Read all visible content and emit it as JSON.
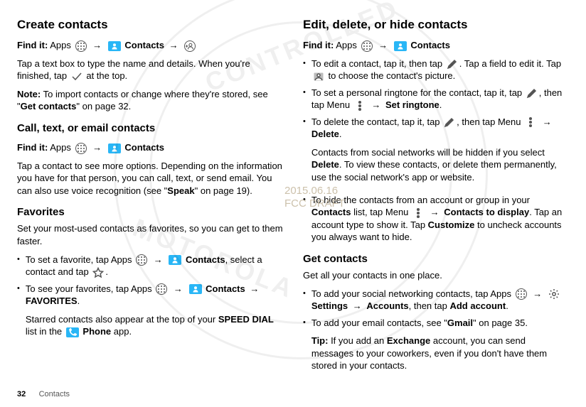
{
  "page": {
    "number": "32",
    "section": "Contacts",
    "arrow": "→"
  },
  "left": {
    "h1": "Create contacts",
    "find1_label": "Find it:",
    "find1_a": "Apps",
    "find1_b": "Contacts",
    "p1a": "Tap a text box to type the name and details. When you're finished, tap ",
    "p1b": " at the top.",
    "note_label": "Note:",
    "note_a": " To import contacts or change where they're stored, see \"",
    "note_b": "Get contacts",
    "note_c": "\" on page 32.",
    "h2": "Call, text, or email contacts",
    "find2_label": "Find it:",
    "find2_a": "Apps",
    "find2_b": "Contacts",
    "p2a": "Tap a contact to see more options. Depending on the information you have for that person, you can call, text, or send email. You can also use voice recognition (see \"",
    "p2b": "Speak",
    "p2c": "\" on page 19).",
    "h3": "Favorites",
    "p3": "Set your most-used contacts as favorites, so you can get to them faster.",
    "b1a": "To set a favorite, tap Apps ",
    "b1b": "Contacts",
    "b1c": ", select a contact and tap ",
    "b1d": ".",
    "b2a": "To see your favorites, tap Apps ",
    "b2b": "Contacts",
    "b2c": "FAVORITES",
    "b2d": ".",
    "b2e": "Starred contacts also appear at the top of your ",
    "b2f": "SPEED DIAL",
    "b2g": " list in the ",
    "b2h": "Phone",
    "b2i": " app."
  },
  "right": {
    "h1": "Edit, delete, or hide contacts",
    "find1_label": "Find it:",
    "find1_a": "Apps",
    "find1_b": "Contacts",
    "e1a": "To edit a contact, tap it, then tap ",
    "e1b": ". Tap a field to edit it. Tap ",
    "e1c": " to choose the contact's picture.",
    "e2a": "To set a personal ringtone for the contact, tap it, tap ",
    "e2b": ", then tap Menu ",
    "e2c": "Set ringtone",
    "e2d": ".",
    "e3a": "To delete the contact, tap it, tap ",
    "e3b": ", then tap Menu ",
    "e3c": "Delete",
    "e3d": ".",
    "e3e": "Contacts from social networks will be hidden if you select ",
    "e3f": "Delete",
    "e3g": ". To view these contacts, or delete them permanently, use the social network's app or website.",
    "e4a": "To hide the contacts from an account or group in your ",
    "e4b": "Contacts",
    "e4c": " list, tap Menu ",
    "e4d": "Contacts to display",
    "e4e": ". Tap an account type to show it. Tap ",
    "e4f": "Customize",
    "e4g": " to uncheck accounts you always want to hide.",
    "h2": "Get contacts",
    "p2": "Get all your contacts in one place.",
    "g1a": "To add your social networking contacts, tap Apps ",
    "g1b": "Settings",
    "g1c": "Accounts",
    "g1d": ", then tap ",
    "g1e": "Add account",
    "g1f": ".",
    "g2a": "To add your email contacts, see \"",
    "g2b": "Gmail",
    "g2c": "\" on page 35.",
    "tip_label": "Tip:",
    "tip_a": " If you add an ",
    "tip_b": "Exchange",
    "tip_c": " account, you can send messages to your coworkers, even if you don't have them stored in your contacts."
  },
  "stamp": {
    "l1": "2015.06.16",
    "l2": "FCC DRAFT"
  }
}
